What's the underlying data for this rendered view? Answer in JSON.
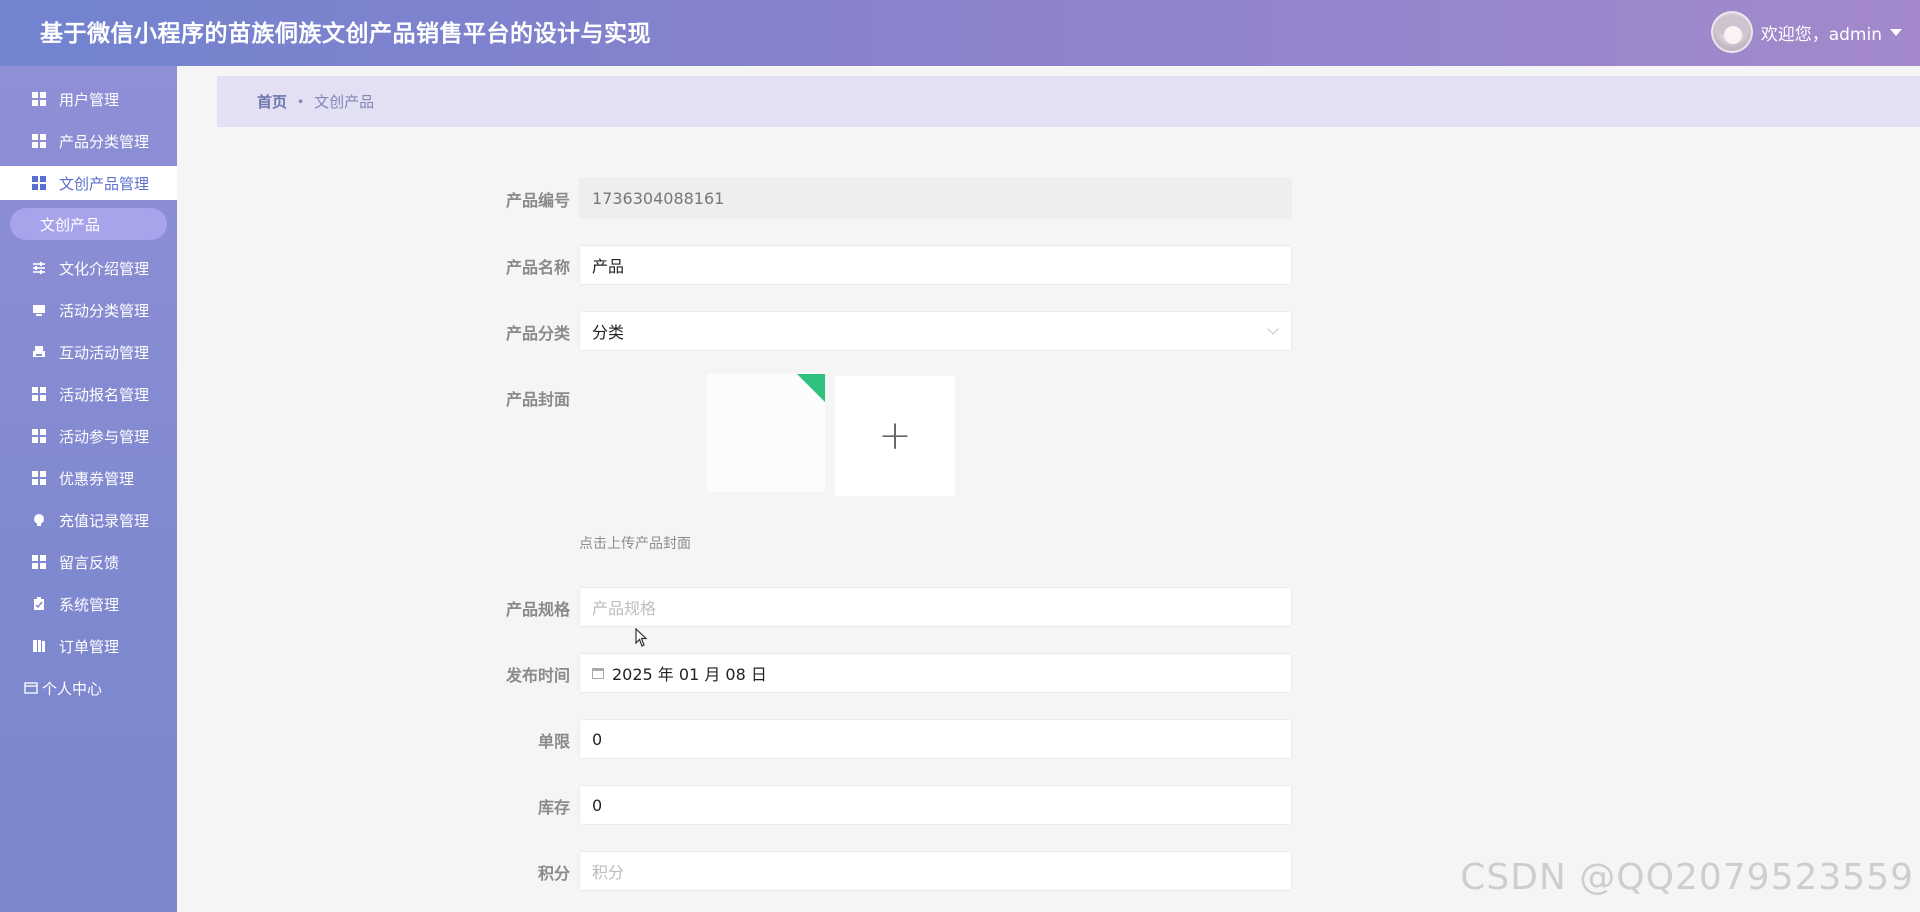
{
  "header": {
    "title": "基于微信小程序的苗族侗族文创产品销售平台的设计与实现",
    "welcome": "欢迎您，admin"
  },
  "sidebar": {
    "items": [
      {
        "label": "用户管理",
        "icon": "grid-icon"
      },
      {
        "label": "产品分类管理",
        "icon": "grid-icon"
      },
      {
        "label": "文创产品管理",
        "icon": "grid-icon"
      },
      {
        "label": "文化介绍管理",
        "icon": "sliders-icon"
      },
      {
        "label": "活动分类管理",
        "icon": "monitor-icon"
      },
      {
        "label": "互动活动管理",
        "icon": "printer-icon"
      },
      {
        "label": "活动报名管理",
        "icon": "grid-icon"
      },
      {
        "label": "活动参与管理",
        "icon": "grid-icon"
      },
      {
        "label": "优惠券管理",
        "icon": "grid-icon"
      },
      {
        "label": "充值记录管理",
        "icon": "bulb-icon"
      },
      {
        "label": "留言反馈",
        "icon": "grid-icon"
      },
      {
        "label": "系统管理",
        "icon": "clipboard-icon"
      },
      {
        "label": "订单管理",
        "icon": "book-icon"
      },
      {
        "label": "个人中心",
        "icon": "card-icon"
      }
    ],
    "sub_item": "文创产品"
  },
  "breadcrumb": {
    "home": "首页",
    "separator": "•",
    "current": "文创产品"
  },
  "form": {
    "code": {
      "label": "产品编号",
      "value": "1736304088161"
    },
    "name": {
      "label": "产品名称",
      "value": "产品"
    },
    "category": {
      "label": "产品分类",
      "value": "分类"
    },
    "cover": {
      "label": "产品封面",
      "tip": "点击上传产品封面"
    },
    "spec": {
      "label": "产品规格",
      "placeholder": "产品规格"
    },
    "publish_time": {
      "label": "发布时间",
      "value": "2025 年 01 月 08 日"
    },
    "limit": {
      "label": "单限",
      "value": "0"
    },
    "stock": {
      "label": "库存",
      "value": "0"
    },
    "points": {
      "label": "积分",
      "placeholder": "积分"
    }
  },
  "watermark": "CSDN @QQ2079523559",
  "colors": {
    "header_start": "#7283cf",
    "header_end": "#a389cb",
    "sidebar": "#8588d2",
    "active_text": "#5b6fd0",
    "upload_corner": "#2fc07e"
  }
}
